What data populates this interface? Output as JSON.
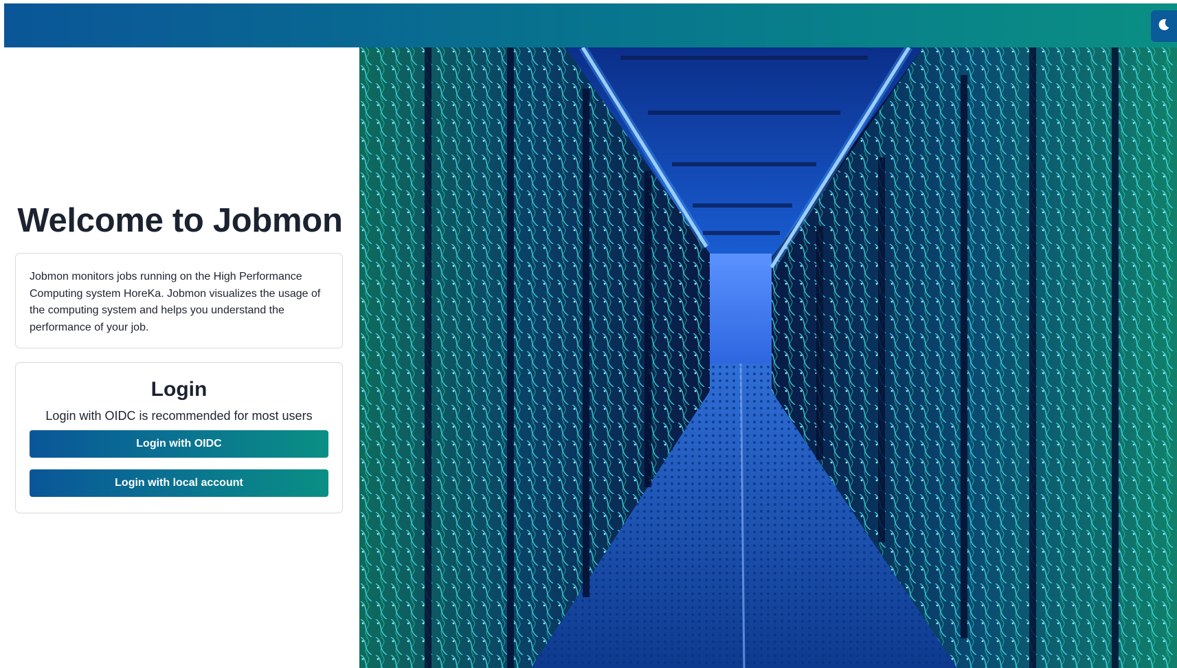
{
  "header": {
    "theme_toggle_icon": "moon-icon",
    "gradient_start": "#0a5698",
    "gradient_end": "#0a8f84"
  },
  "welcome": {
    "title": "Welcome to Jobmon",
    "description": "Jobmon monitors jobs running on the High Performance Computing system HoreKa. Jobmon visualizes the usage of the computing system and helps you understand the performance of your job."
  },
  "login": {
    "title": "Login",
    "subtitle": "Login with OIDC is recommended for most users",
    "oidc_button": "Login with OIDC",
    "local_button": "Login with local account"
  },
  "hero": {
    "image": "datacenter-corridor-photo",
    "accent": "#1a8cff"
  }
}
